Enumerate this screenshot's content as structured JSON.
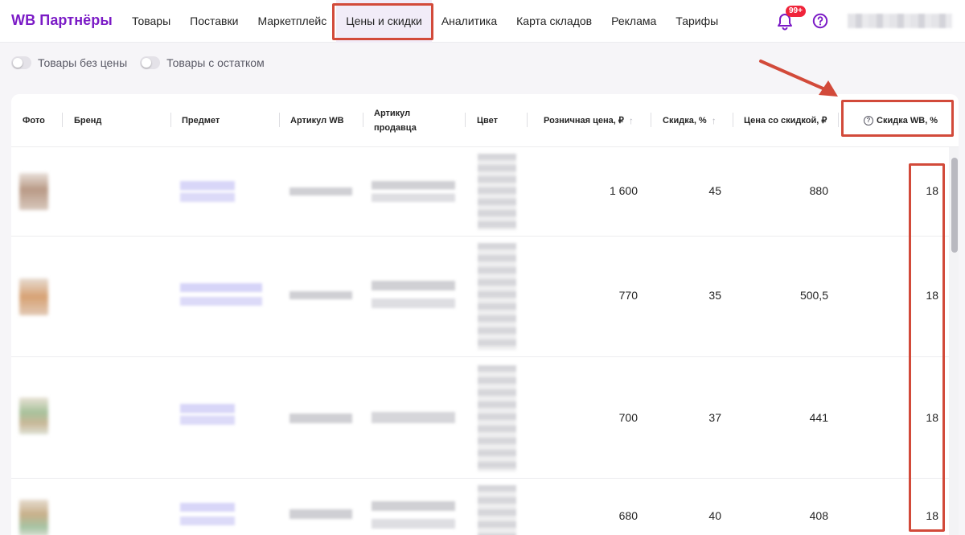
{
  "header": {
    "logo": "WB Партнёры",
    "nav": [
      "Товары",
      "Поставки",
      "Маркетплейс",
      "Цены и скидки",
      "Аналитика",
      "Карта складов",
      "Реклама",
      "Тарифы"
    ],
    "active_nav": "Цены и скидки",
    "notifications_badge": "99+"
  },
  "filters": {
    "toggle_no_price": "Товары без цены",
    "toggle_in_stock": "Товары с остатком"
  },
  "table": {
    "columns": {
      "photo": "Фото",
      "brand": "Бренд",
      "subject": "Предмет",
      "article_wb": "Артикул WB",
      "article_seller_1": "Артикул",
      "article_seller_2": "продавца",
      "color": "Цвет",
      "retail_price": "Розничная цена, ₽",
      "discount": "Скидка, %",
      "price_discount": "Цена со скидкой, ₽",
      "wb_discount": "Скидка WB, %"
    },
    "rows": [
      {
        "retail_price": "1 600",
        "discount": "45",
        "price_discount": "880",
        "wb_discount": "18"
      },
      {
        "retail_price": "770",
        "discount": "35",
        "price_discount": "500,5",
        "wb_discount": "18"
      },
      {
        "retail_price": "700",
        "discount": "37",
        "price_discount": "441",
        "wb_discount": "18"
      },
      {
        "retail_price": "680",
        "discount": "40",
        "price_discount": "408",
        "wb_discount": "18"
      }
    ]
  },
  "colors": {
    "brand": "#7b1bc6",
    "annotation": "#d24a3a",
    "active_tab_bg": "#f1ecf8"
  },
  "icons": [
    "bell-icon",
    "help-icon",
    "question-circle-icon",
    "sort-arrow-up-icon"
  ]
}
